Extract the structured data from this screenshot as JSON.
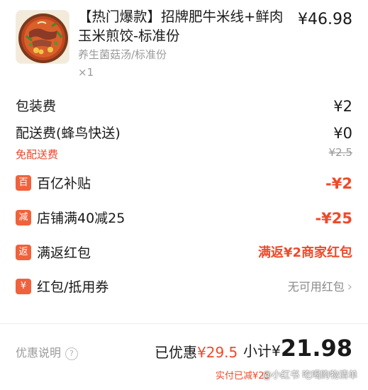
{
  "product": {
    "title": "【热门爆款】招牌肥牛米线+鲜肉玉米煎饺-标准份",
    "price": "¥46.98",
    "spec": "养生菌菇汤/标准份",
    "qty": "×1",
    "thumb_icon": "noodle-bowl-photo"
  },
  "fees": {
    "packaging_label": "包装费",
    "packaging_value": "¥2",
    "delivery_label": "配送费(蜂鸟快送)",
    "delivery_value": "¥0",
    "free_delivery_label": "免配送费",
    "original_delivery": "¥2.5"
  },
  "discounts": [
    {
      "badge": "百",
      "label": "百亿补贴",
      "value": "-¥2"
    },
    {
      "badge": "减",
      "label": "店铺满40减25",
      "value": "-¥25"
    },
    {
      "badge": "返",
      "label": "满返红包",
      "value": "满返¥2商家红包"
    },
    {
      "badge": "¥",
      "label": "红包/抵用券",
      "value": "无可用红包"
    }
  ],
  "footer": {
    "explain_label": "优惠说明",
    "saved_label": "已优惠",
    "saved_amount": "¥29.5",
    "subtotal_label": "小计",
    "subtotal_currency": "¥",
    "subtotal_value": "21.98",
    "paid_note": "实付已减¥25",
    "watermark": "@小红书 吃喝购物清单"
  },
  "colors": {
    "accent_red": "#ee4a2a",
    "badge_orange": "#f0623c",
    "muted_gray": "#9a9a9a"
  }
}
